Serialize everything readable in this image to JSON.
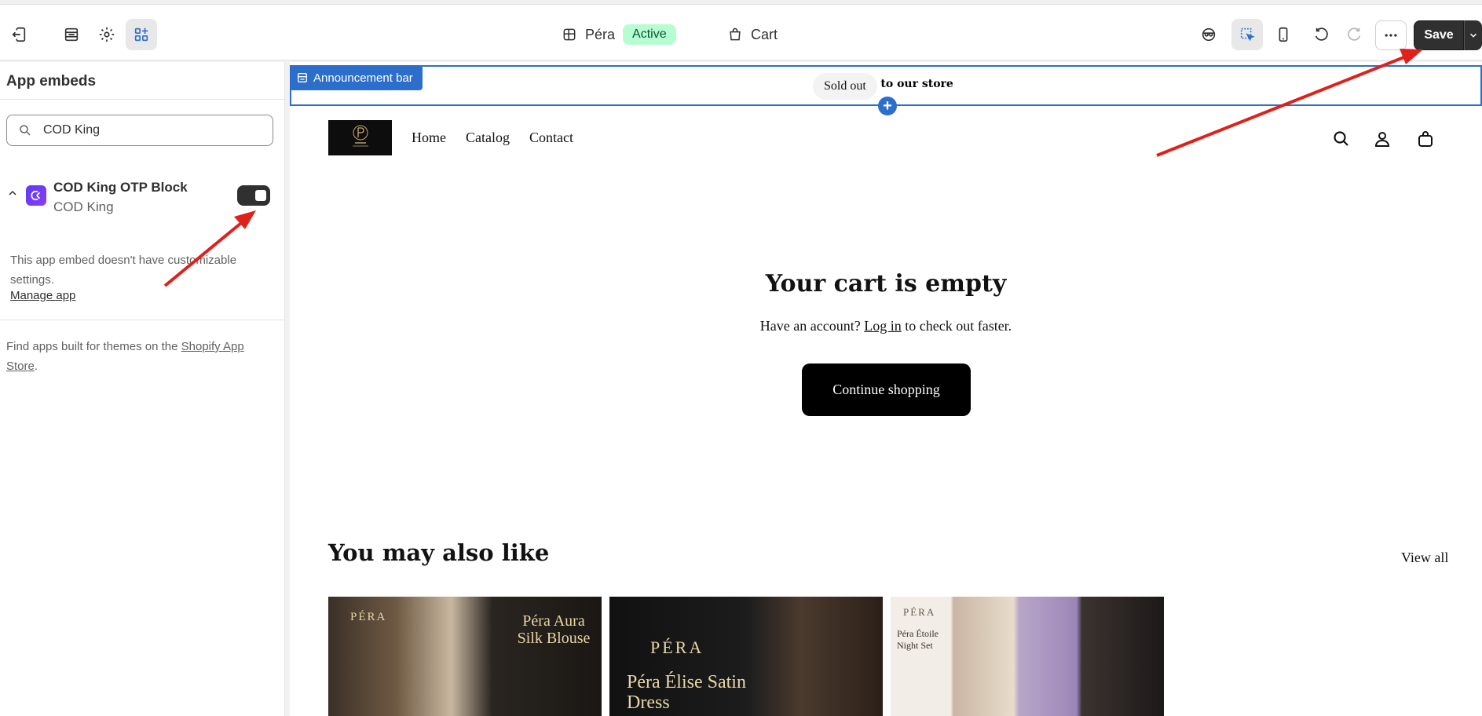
{
  "topbar": {
    "theme_name": "Péra",
    "theme_status": "Active",
    "page_label": "Cart",
    "save_label": "Save"
  },
  "sidebar": {
    "title": "App embeds",
    "search_value": "COD King",
    "embed": {
      "name": "COD King OTP Block",
      "app": "COD King",
      "enabled": true
    },
    "note": "This app embed doesn't have customizable settings.",
    "manage_link": "Manage app",
    "footer_prefix": "Find apps built for themes on the ",
    "footer_link": "Shopify App Store",
    "footer_suffix": "."
  },
  "preview": {
    "section_tag": "Announcement bar",
    "announcement": "Welcome to our store",
    "nav": [
      "Home",
      "Catalog",
      "Contact"
    ],
    "cart_title": "Your cart is empty",
    "account_prefix": "Have an account? ",
    "login_link": "Log in",
    "account_suffix": " to check out faster.",
    "continue_label": "Continue shopping",
    "also_title": "You may also like",
    "view_all": "View all",
    "products": [
      {
        "brand": "PÉRA",
        "title": "Péra Aura Silk Blouse"
      },
      {
        "brand": "PÉRA",
        "title": "Péra Élise Satin Dress",
        "badge": "Sold out"
      },
      {
        "brand": "PÉRA",
        "title": "Péra Étoile Night Set"
      }
    ]
  },
  "colors": {
    "accent": "#2c6ecb",
    "save_bg": "#303030",
    "active_badge": "#b4fed2",
    "annotation": "#e0201b"
  }
}
